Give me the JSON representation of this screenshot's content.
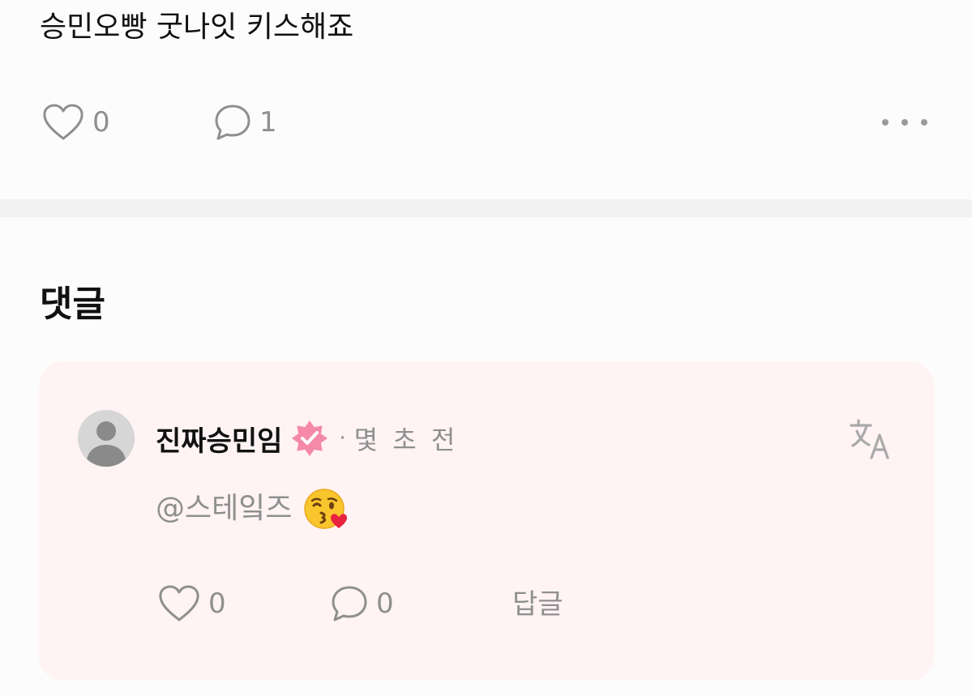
{
  "post": {
    "text": "승민오빵 굿나잇 키스해죠",
    "like_count": "0",
    "comment_count": "1",
    "icons": {
      "like": "heart-outline-icon",
      "comment": "speech-bubble-icon",
      "more": "more-horizontal-icon"
    }
  },
  "comments": {
    "heading": "댓글",
    "items": [
      {
        "author": "진짜승민임",
        "verified": true,
        "separator": "·",
        "time": "몇 초 전",
        "text": "@스테잌즈",
        "emoji": "kissing-face-with-heart-emoji",
        "like_count": "0",
        "reply_count": "0",
        "reply_label": "답글"
      }
    ]
  },
  "colors": {
    "background": "#fdfcfc",
    "divider": "#f3f2f2",
    "comment_card": "#fff3f4",
    "muted_text": "#8f8f8f",
    "badge_pink": "#f48aa8"
  }
}
